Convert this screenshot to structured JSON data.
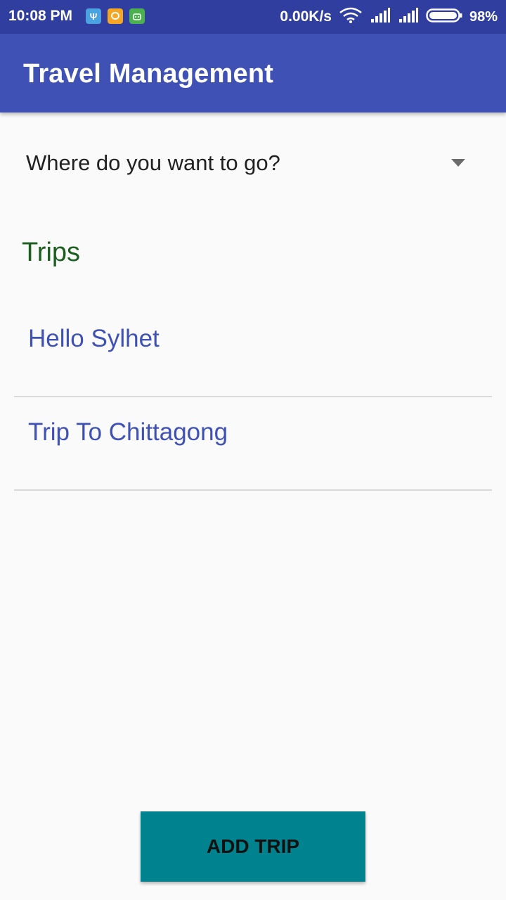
{
  "status_bar": {
    "time": "10:08 PM",
    "network_speed": "0.00K/s",
    "battery": "98%",
    "icons": [
      "usb-icon",
      "chat-notification-icon",
      "android-notification-icon",
      "wifi-icon",
      "signal-icon",
      "signal-icon",
      "battery-icon"
    ]
  },
  "app_bar": {
    "title": "Travel Management"
  },
  "destination_spinner": {
    "placeholder": "Where do you want to go?"
  },
  "trips_section": {
    "title": "Trips",
    "items": [
      {
        "label": "Hello Sylhet"
      },
      {
        "label": "Trip To Chittagong"
      }
    ]
  },
  "actions": {
    "add_trip_label": "ADD TRIP"
  },
  "colors": {
    "primary": "#3f51b5",
    "primary_dark": "#303f9f",
    "section_title": "#1b5e20",
    "button": "#00838f"
  }
}
